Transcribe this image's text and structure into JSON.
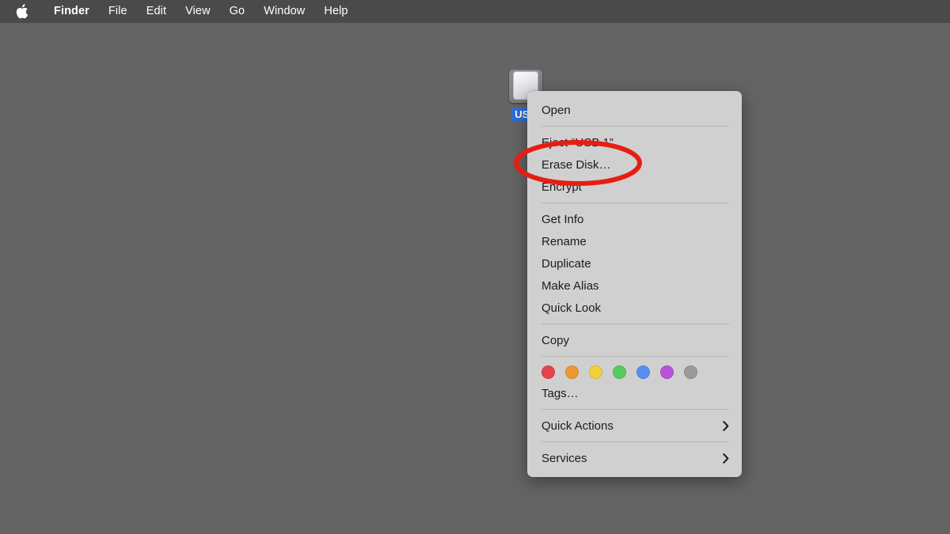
{
  "menubar": {
    "apple_icon": "apple-logo-icon",
    "items": [
      {
        "label": "Finder",
        "bold": true
      },
      {
        "label": "File",
        "bold": false
      },
      {
        "label": "Edit",
        "bold": false
      },
      {
        "label": "View",
        "bold": false
      },
      {
        "label": "Go",
        "bold": false
      },
      {
        "label": "Window",
        "bold": false
      },
      {
        "label": "Help",
        "bold": false
      }
    ]
  },
  "desktop": {
    "background_color": "#646464",
    "drive": {
      "icon": "usb-drive-icon",
      "label": "USB 1",
      "label_visible_text": "USB",
      "selected": true,
      "selection_color": "#2f6fd8"
    }
  },
  "context_menu": {
    "background_color": "#d0d0d0",
    "groups": [
      {
        "items": [
          {
            "label": "Open",
            "submenu": false
          }
        ]
      },
      {
        "items": [
          {
            "label": "Eject “USB 1”",
            "submenu": false
          },
          {
            "label": "Erase Disk…",
            "submenu": false,
            "highlighted_by_annotation": true
          },
          {
            "label": "Encrypt",
            "submenu": false
          }
        ]
      },
      {
        "items": [
          {
            "label": "Get Info",
            "submenu": false
          },
          {
            "label": "Rename",
            "submenu": false
          },
          {
            "label": "Duplicate",
            "submenu": false
          },
          {
            "label": "Make Alias",
            "submenu": false
          },
          {
            "label": "Quick Look",
            "submenu": false
          }
        ]
      },
      {
        "items": [
          {
            "label": "Copy",
            "submenu": false
          }
        ]
      },
      {
        "tags": {
          "colors": [
            "#e8434d",
            "#ef9833",
            "#f2d23c",
            "#56cc5c",
            "#5a8df2",
            "#b953db",
            "#9a9a9a"
          ],
          "names": [
            "red-tag",
            "orange-tag",
            "yellow-tag",
            "green-tag",
            "blue-tag",
            "purple-tag",
            "gray-tag"
          ]
        },
        "items": [
          {
            "label": "Tags…",
            "submenu": false
          }
        ]
      },
      {
        "items": [
          {
            "label": "Quick Actions",
            "submenu": true
          }
        ]
      },
      {
        "items": [
          {
            "label": "Services",
            "submenu": true
          }
        ]
      }
    ]
  },
  "annotation": {
    "shape": "ellipse",
    "color": "#e81d12",
    "stroke_width": 6,
    "targets_label": "Erase Disk…"
  }
}
